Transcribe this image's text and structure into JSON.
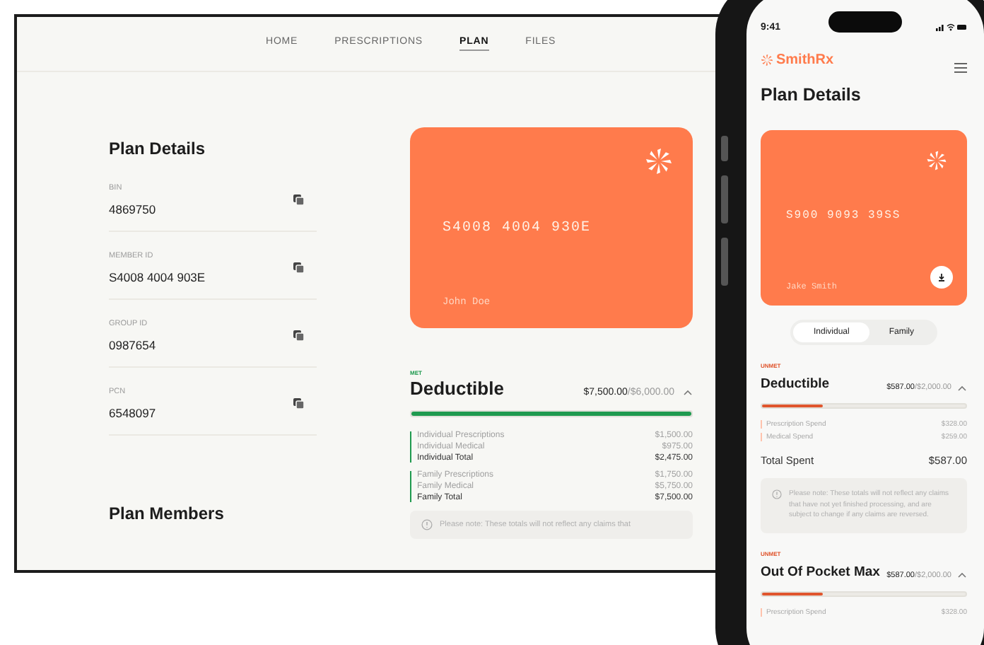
{
  "desktop": {
    "nav": [
      {
        "label": "HOME",
        "selected": false
      },
      {
        "label": "PRESCRIPTIONS",
        "selected": false
      },
      {
        "label": "PLAN",
        "selected": true
      },
      {
        "label": "FILES",
        "selected": false
      }
    ],
    "plan_details": {
      "title": "Plan Details",
      "fields": [
        {
          "label": "BIN",
          "value": "4869750"
        },
        {
          "label": "MEMBER ID",
          "value": "S4008 4004 903E"
        },
        {
          "label": "GROUP ID",
          "value": "0987654"
        },
        {
          "label": "PCN",
          "value": "6548097"
        }
      ]
    },
    "plan_members_title": "Plan Members",
    "card": {
      "number": "S4008 4004 930E",
      "name": "John Doe"
    },
    "deductible": {
      "met": true,
      "status": "MET",
      "title": "Deductible",
      "spent": "$7,500.00",
      "limit": "/$6,000.00",
      "expanded": true,
      "level": 1,
      "groups": [
        {
          "rows": [
            {
              "kind": "item",
              "label": "Individual Prescriptions",
              "value": "$1,500.00"
            },
            {
              "kind": "item",
              "label": "Individual Medical",
              "value": "$975.00"
            },
            {
              "kind": "total",
              "label": "Individual Total",
              "value": "$2,475.00"
            }
          ]
        },
        {
          "rows": [
            {
              "kind": "item",
              "label": "Family Prescriptions",
              "value": "$1,750.00"
            },
            {
              "kind": "item",
              "label": "Family Medical",
              "value": "$5,750.00"
            },
            {
              "kind": "total",
              "label": "Family Total",
              "value": "$7,500.00"
            }
          ]
        }
      ],
      "note": "Please note: These totals will not reflect any claims that"
    }
  },
  "phone": {
    "time": "9:41",
    "logo": "SmithRx",
    "title": "Plan Details",
    "card": {
      "number": "S900 9093 39SS",
      "name": "Jake Smith"
    },
    "segments": [
      {
        "label": "Individual",
        "selected": true
      },
      {
        "label": "Family",
        "selected": false
      }
    ],
    "sections": [
      {
        "met": false,
        "status": "UNMET",
        "title": "Deductible",
        "spent": "$587.00",
        "limit": "/$2,000.00",
        "expanded": true,
        "level": 0.3,
        "rows": [
          {
            "label": "Prescription Spend",
            "value": "$328.00"
          },
          {
            "label": "Medical Spend",
            "value": "$259.00"
          }
        ],
        "total_label": "Total Spent",
        "total_value": "$587.00",
        "note": "Please note: These totals will not reflect any claims that have not yet finished processing, and are subject to change if any claims are reversed."
      },
      {
        "met": false,
        "status": "UNMET",
        "title": "Out Of Pocket Max",
        "spent": "$587.00",
        "limit": "/$2,000.00",
        "expanded": true,
        "level": 0.3,
        "rows": [
          {
            "label": "Prescription Spend",
            "value": "$328.00"
          }
        ]
      }
    ]
  }
}
